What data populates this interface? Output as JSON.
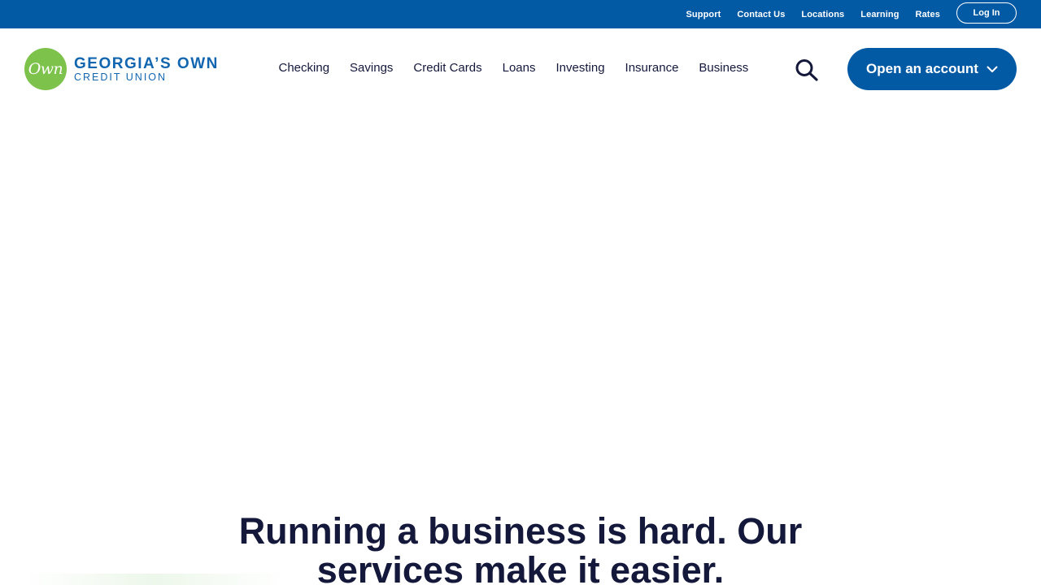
{
  "utility_nav": {
    "links": [
      "Support",
      "Contact Us",
      "Locations",
      "Learning",
      "Rates"
    ],
    "login_label": "Log In"
  },
  "logo": {
    "badge_text": "Own",
    "line1": "GEORGIA’S OWN",
    "line2": "CREDIT UNION"
  },
  "main_nav": {
    "items": [
      "Checking",
      "Savings",
      "Credit Cards",
      "Loans",
      "Investing",
      "Insurance",
      "Business"
    ],
    "search_icon": "search-icon"
  },
  "cta": {
    "open_account_label": "Open an account",
    "chevron_icon": "chevron-down-icon"
  },
  "hero": {
    "heading_line1": "Running a business is hard. Our",
    "heading_line2": "services make it easier."
  },
  "colors": {
    "brand_blue": "#025aa5",
    "logo_green": "#7dc24b",
    "text_dark": "#14183a"
  }
}
